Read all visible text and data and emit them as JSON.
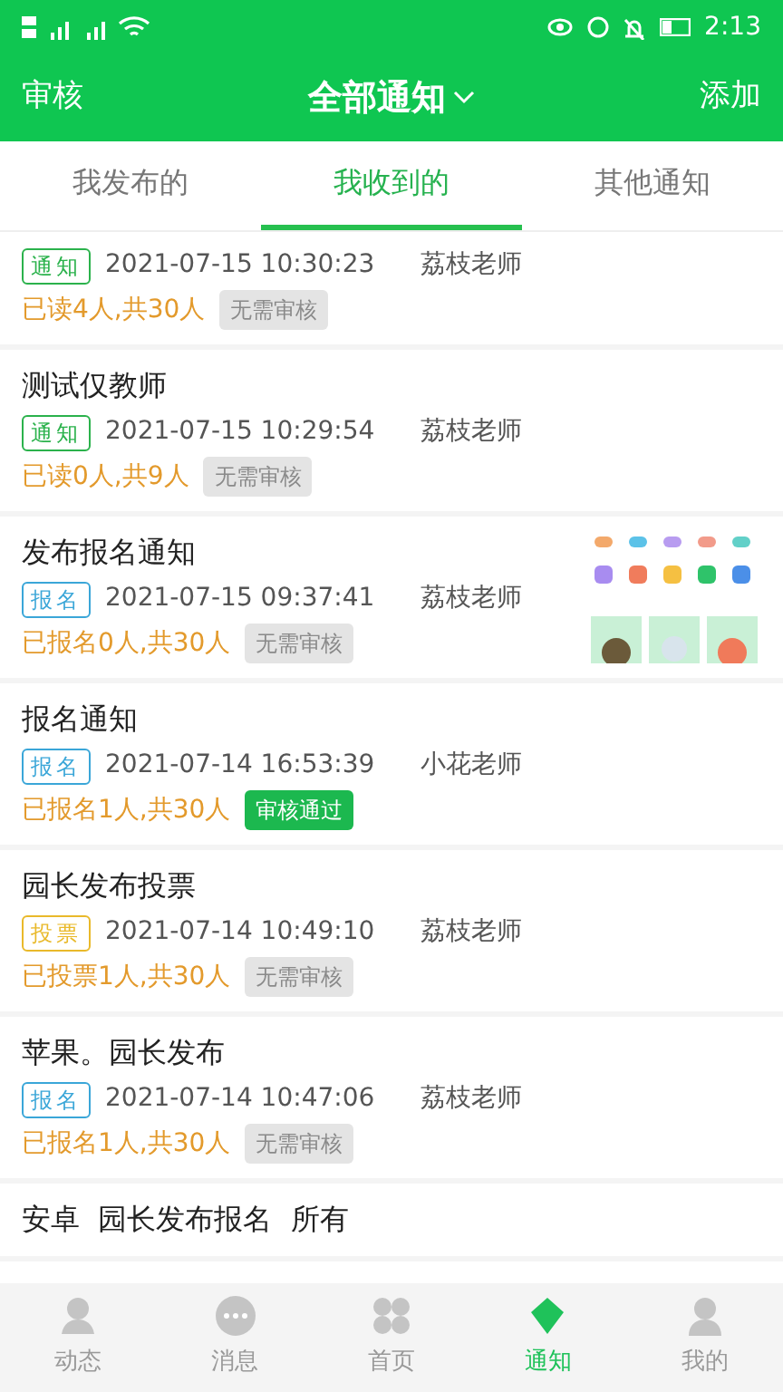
{
  "status_bar": {
    "time": "2:13"
  },
  "header": {
    "left": "审核",
    "title": "全部通知",
    "right": "添加"
  },
  "tabs": [
    {
      "label": "我发布的",
      "selected": false
    },
    {
      "label": "我收到的",
      "selected": true
    },
    {
      "label": "其他通知",
      "selected": false
    }
  ],
  "notices": [
    {
      "tag": "通知",
      "color": "#2bb24c",
      "time": "2021-07-15 10:30:23",
      "author": "荔枝老师",
      "stats": "已读4人,共30人",
      "status": "无需审核",
      "approved": false
    },
    {
      "title": "测试仅教师",
      "tag": "通知",
      "color": "#2bb24c",
      "time": "2021-07-15 10:29:54",
      "author": "荔枝老师",
      "stats": "已读0人,共9人",
      "status": "无需审核",
      "approved": false
    },
    {
      "title": "发布报名通知",
      "tag": "报名",
      "color": "#3aa6d8",
      "time": "2021-07-15 09:37:41",
      "author": "荔枝老师",
      "stats": "已报名0人,共30人",
      "status": "无需审核",
      "approved": false
    },
    {
      "title": "报名通知",
      "tag": "报名",
      "color": "#3aa6d8",
      "time": "2021-07-14 16:53:39",
      "author": "小花老师",
      "stats": "已报名1人,共30人",
      "status": "审核通过",
      "approved": true
    },
    {
      "title": "园长发布投票",
      "tag": "投票",
      "color": "#e9b92a",
      "time": "2021-07-14 10:49:10",
      "author": "荔枝老师",
      "stats": "已投票1人,共30人",
      "status": "无需审核",
      "approved": false
    },
    {
      "title": "苹果。园长发布",
      "tag": "报名",
      "color": "#3aa6d8",
      "time": "2021-07-14 10:47:06",
      "author": "荔枝老师",
      "stats": "已报名1人,共30人",
      "status": "无需审核",
      "approved": false
    },
    {
      "title": "安卓  园长发布报名  所有"
    }
  ],
  "nav": [
    {
      "label": "动态",
      "selected": false
    },
    {
      "label": "消息",
      "selected": false
    },
    {
      "label": "首页",
      "selected": false
    },
    {
      "label": "通知",
      "selected": true
    },
    {
      "label": "我的",
      "selected": false
    }
  ]
}
